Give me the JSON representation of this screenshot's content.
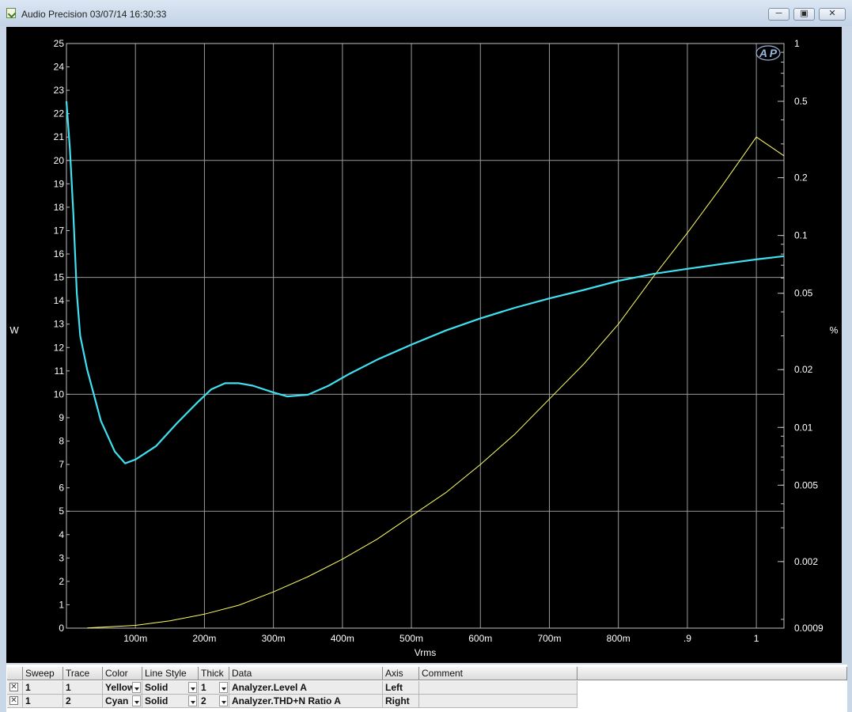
{
  "window": {
    "title": "Audio Precision  03/07/14 16:30:33",
    "minimize_icon": "minimize-icon",
    "maximize_icon": "maximize-icon",
    "close_icon": "close-icon"
  },
  "chart_data": {
    "type": "line",
    "xlabel": "Vrms",
    "ylabel_left": "W",
    "ylabel_right": "%",
    "logo": "AP",
    "grid": true,
    "background": "#000000",
    "x_ticks": [
      "100m",
      "200m",
      "300m",
      "400m",
      "500m",
      "600m",
      "700m",
      "800m",
      ".9",
      "1"
    ],
    "y_left_ticks": [
      "0",
      "1",
      "2",
      "3",
      "4",
      "5",
      "6",
      "7",
      "8",
      "9",
      "10",
      "11",
      "12",
      "13",
      "14",
      "15",
      "16",
      "17",
      "18",
      "19",
      "20",
      "21",
      "22",
      "23",
      "24",
      "25"
    ],
    "y_right_ticks": [
      "1",
      "0.5",
      "0.2",
      "0.1",
      "0.05",
      "0.02",
      "0.01",
      "0.005",
      "0.002",
      "0.0009"
    ],
    "xlim": [
      0,
      1.04
    ],
    "ylim_left": [
      0,
      25
    ],
    "ylim_right": [
      0.0009,
      1
    ],
    "right_axis_scale": "log",
    "series": [
      {
        "color": "#ffff66",
        "axis": "left",
        "x": [
          0.03,
          0.1,
          0.15,
          0.2,
          0.25,
          0.3,
          0.35,
          0.4,
          0.45,
          0.5,
          0.55,
          0.6,
          0.65,
          0.7,
          0.75,
          0.8,
          0.85,
          0.9,
          0.95,
          1.0,
          1.04
        ],
        "values": [
          0.01,
          0.12,
          0.31,
          0.6,
          0.98,
          1.55,
          2.2,
          2.95,
          3.8,
          4.8,
          5.8,
          7.0,
          8.3,
          9.8,
          11.3,
          13.0,
          15.0,
          16.9,
          18.9,
          21.0,
          20.2
        ]
      },
      {
        "color": "#40e0f0",
        "axis": "right",
        "x": [
          0.0,
          0.005,
          0.01,
          0.015,
          0.02,
          0.03,
          0.05,
          0.07,
          0.085,
          0.1,
          0.13,
          0.16,
          0.19,
          0.21,
          0.23,
          0.25,
          0.27,
          0.3,
          0.32,
          0.35,
          0.38,
          0.41,
          0.45,
          0.5,
          0.55,
          0.6,
          0.65,
          0.7,
          0.75,
          0.8,
          0.85,
          0.9,
          0.95,
          1.0,
          1.04
        ],
        "values": [
          0.5,
          0.28,
          0.13,
          0.05,
          0.03,
          0.02,
          0.0108,
          0.0075,
          0.0065,
          0.0068,
          0.008,
          0.0105,
          0.0135,
          0.0158,
          0.017,
          0.017,
          0.0165,
          0.0152,
          0.0145,
          0.0148,
          0.0165,
          0.019,
          0.0225,
          0.027,
          0.032,
          0.037,
          0.042,
          0.047,
          0.052,
          0.058,
          0.063,
          0.067,
          0.071,
          0.075,
          0.078
        ]
      }
    ]
  },
  "table": {
    "columns": [
      "Sweep",
      "Trace",
      "Color",
      "Line Style",
      "Thick",
      "Data",
      "Axis",
      "Comment"
    ],
    "rows": [
      {
        "checked": true,
        "sweep": "1",
        "trace": "1",
        "color": "Yellow",
        "line_style": "Solid",
        "thick": "1",
        "data": "Analyzer.Level A",
        "axis": "Left",
        "comment": ""
      },
      {
        "checked": true,
        "sweep": "1",
        "trace": "2",
        "color": "Cyan",
        "line_style": "Solid",
        "thick": "2",
        "data": "Analyzer.THD+N Ratio A",
        "axis": "Right",
        "comment": ""
      }
    ]
  }
}
